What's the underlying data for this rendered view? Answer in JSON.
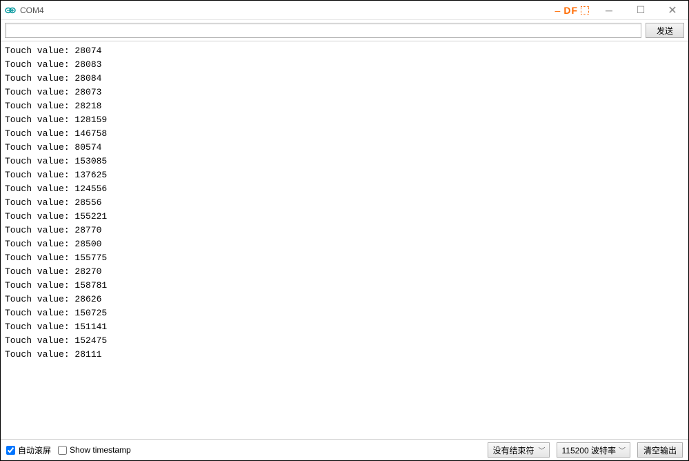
{
  "titlebar": {
    "title": "COM4",
    "watermark_text": "DF"
  },
  "sendrow": {
    "input_value": "",
    "send_label": "发送"
  },
  "output": {
    "prefix": "Touch value:",
    "values": [
      28074,
      28083,
      28084,
      28073,
      28218,
      128159,
      146758,
      80574,
      153085,
      137625,
      124556,
      28556,
      155221,
      28770,
      28500,
      155775,
      28270,
      158781,
      28626,
      150725,
      151141,
      152475,
      28111
    ]
  },
  "bottombar": {
    "autoscroll_label": "自动滚屏",
    "autoscroll_checked": true,
    "timestamp_label": "Show timestamp",
    "timestamp_checked": false,
    "line_ending_selected": "没有结束符",
    "baud_selected": "115200 波特率",
    "clear_label": "清空输出"
  }
}
